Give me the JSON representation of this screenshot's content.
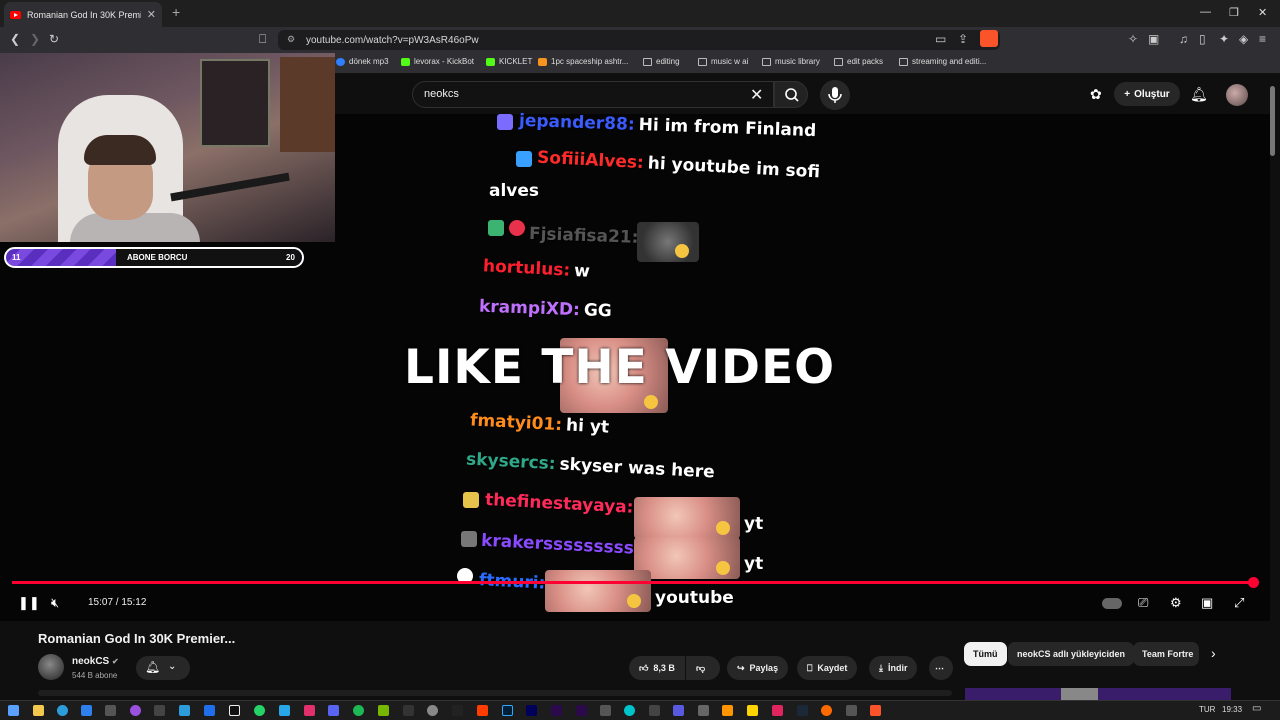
{
  "browser": {
    "tab_title": "Romanian God In 30K Premier...",
    "new_tab": "+",
    "url": "youtube.com/watch?v=pW3AsR46oPw",
    "window_buttons": [
      "—",
      "❐",
      "✕"
    ]
  },
  "bookmarks": [
    "dönek mp3",
    "levorax - KickBot",
    "KICKLET",
    "1pc spaceship ashtr...",
    "editing",
    "music w ai",
    "music library",
    "edit packs",
    "streaming and editi..."
  ],
  "youtube": {
    "search_value": "neokcs",
    "create_label": "Oluştur"
  },
  "overlay": {
    "sub_goal_left": "11",
    "sub_goal_label": "ABONE BORCU",
    "sub_goal_right": "20"
  },
  "chat": [
    {
      "user": "jepander88:",
      "msg": "Hi im from Finland",
      "color": "#3a5cff"
    },
    {
      "user": "SofiiiAlves:",
      "msg": "hi youtube im sofi",
      "cont": "alves",
      "color": "#ff2a2a"
    },
    {
      "user": "Fjsiafisa21:",
      "msg": "",
      "color": "#555555"
    },
    {
      "user": "hortulus:",
      "msg": "w",
      "color": "#ff1f2f"
    },
    {
      "user": "krampiXD:",
      "msg": "GG",
      "color": "#c070ff"
    },
    {
      "user": "fmatyi01:",
      "msg": "hi yt",
      "color": "#ff8c1a"
    },
    {
      "user": "skysercs:",
      "msg": "skyser was here",
      "color": "#2fa88a"
    },
    {
      "user": "thefinestayaya:",
      "msg": "yt",
      "color": "#ff2a5a"
    },
    {
      "user": "krakersssssssss:",
      "msg": "yt",
      "color": "#8a4aff"
    },
    {
      "user": "ftmuri:",
      "msg": "youtube",
      "color": "#2a6cff"
    }
  ],
  "big_text": "LIKE THE VIDEO",
  "player": {
    "time": "15:07 / 15:12",
    "progress": 0.995
  },
  "video": {
    "title": "Romanian God In 30K Premier...",
    "channel": "neokCS",
    "subscribers": "544 B abone",
    "likes": "8,3 B",
    "share": "Paylaş",
    "save": "Kaydet",
    "download": "İndir"
  },
  "chips": [
    "Tümü",
    "neokCS adlı yükleyiciden",
    "Team Fortre"
  ],
  "tray": {
    "lang": "TUR",
    "time": "19:33"
  },
  "icons": [
    "youtube-favicon",
    "back-icon",
    "forward-icon",
    "reload-icon",
    "bookmark-icon",
    "brave-icon",
    "search-icon",
    "mic-icon",
    "bell-icon",
    "pause-icon",
    "mute-icon",
    "settings-icon",
    "fullscreen-icon"
  ]
}
